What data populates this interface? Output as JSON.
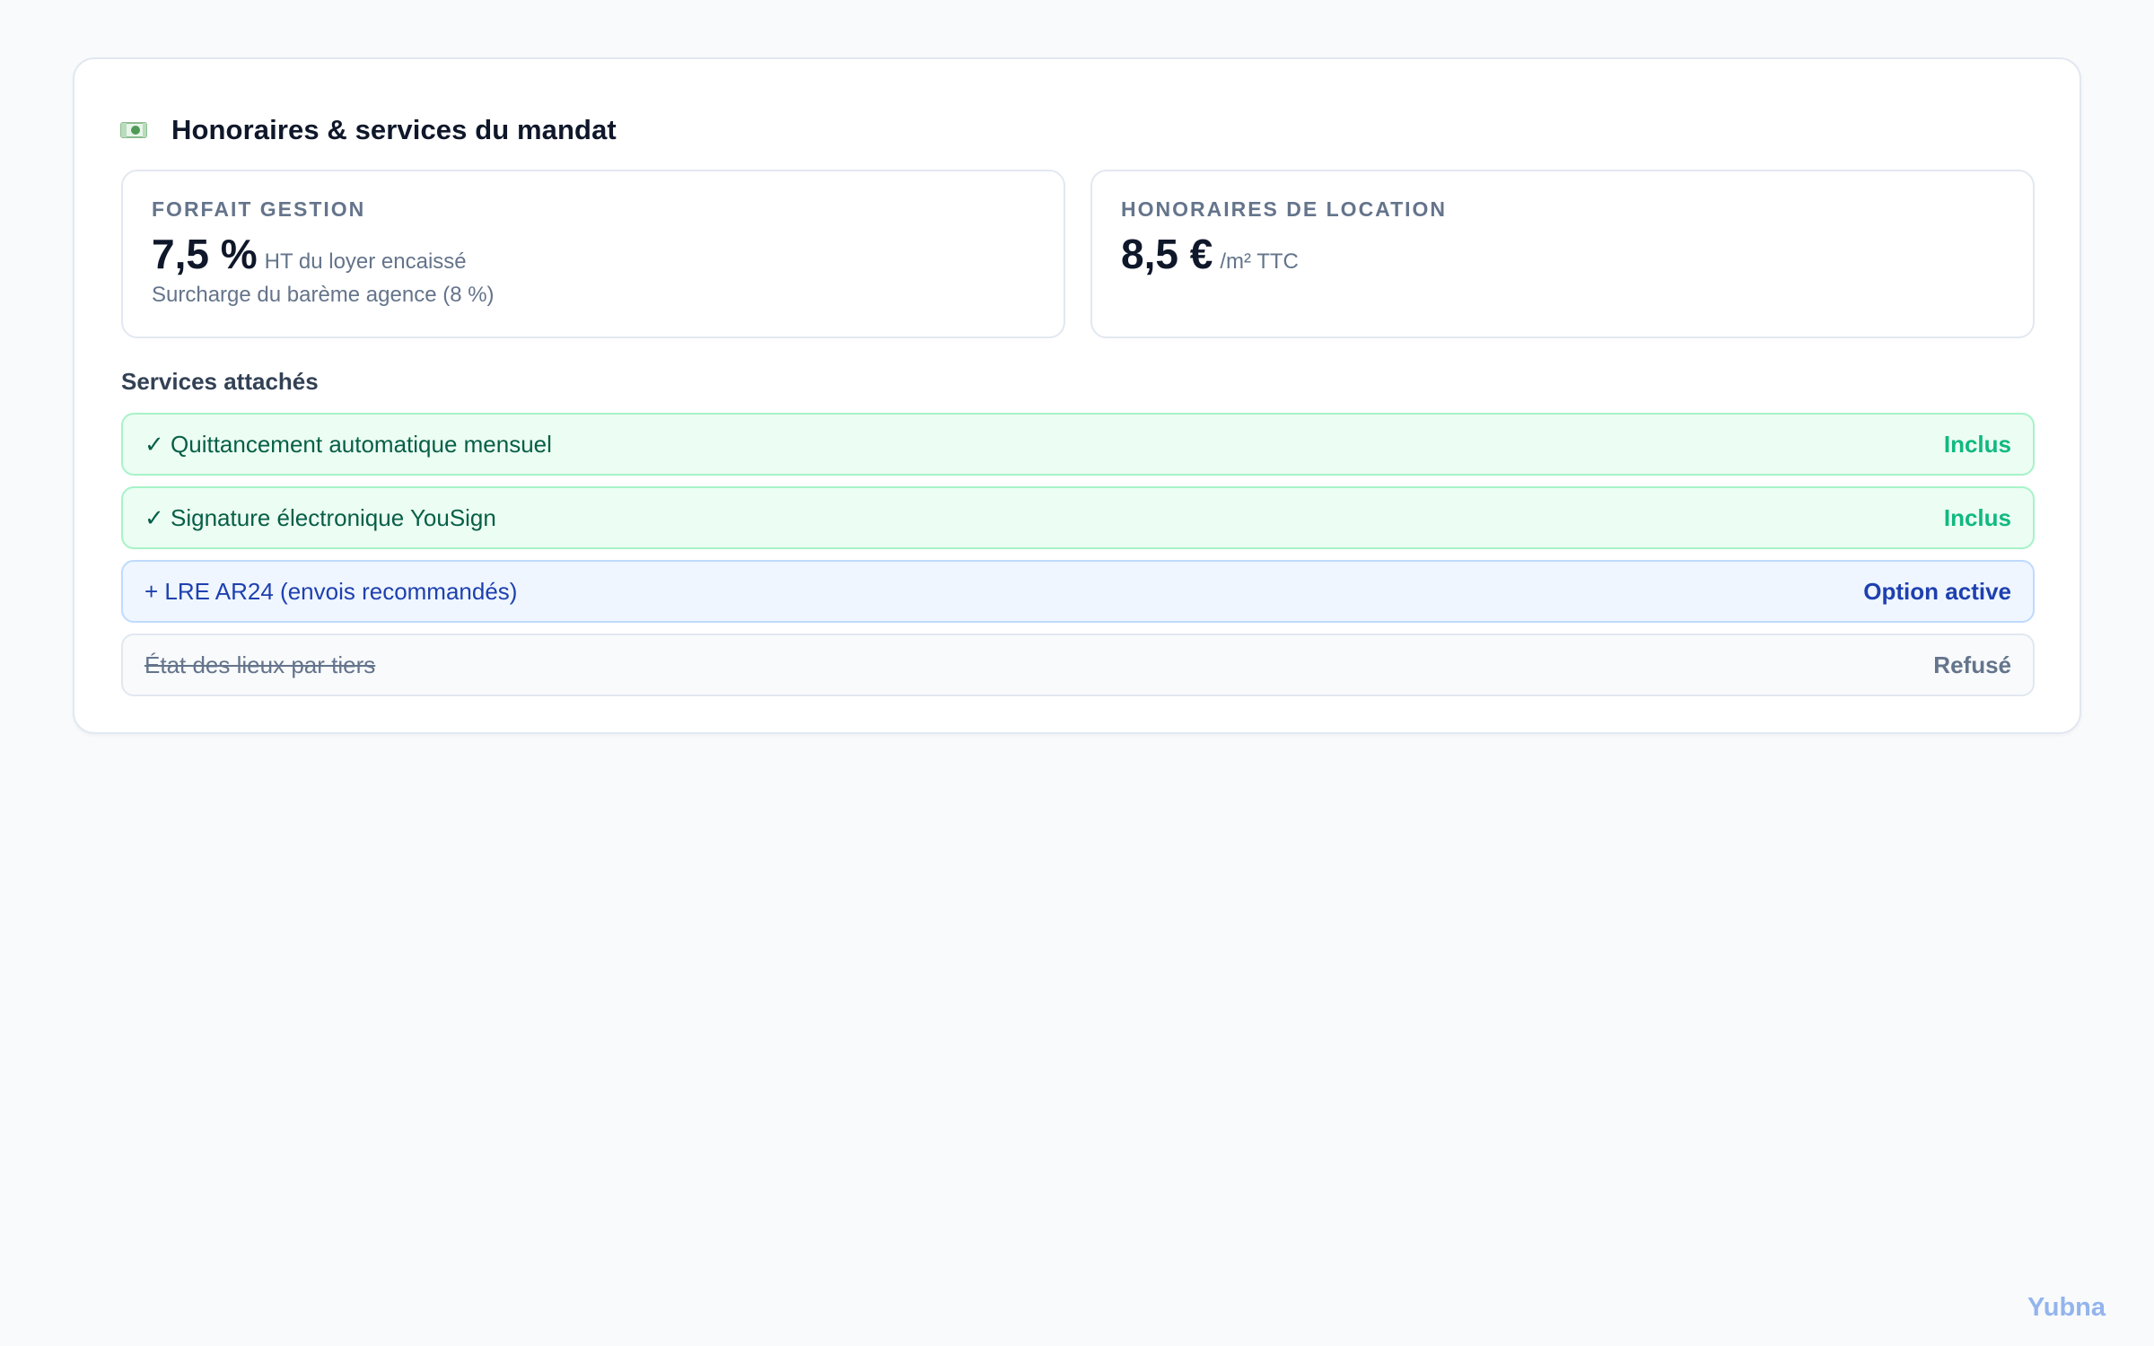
{
  "card": {
    "icon": "money-icon",
    "title": "Honoraires & services du mandat"
  },
  "fees": [
    {
      "label": "FORFAIT GESTION",
      "value": "7,5 %",
      "unit": "HT du loyer encaissé",
      "note": "Surcharge du barème agence (8 %)"
    },
    {
      "label": "HONORAIRES DE LOCATION",
      "value": "8,5 €",
      "unit": "/m² TTC",
      "note": ""
    }
  ],
  "services_section": {
    "title": "Services attachés",
    "items": [
      {
        "name": "✓ Quittancement automatique mensuel",
        "status": "Inclus",
        "state": "included"
      },
      {
        "name": "✓ Signature électronique YouSign",
        "status": "Inclus",
        "state": "included"
      },
      {
        "name": "+ LRE AR24 (envois recommandés)",
        "status": "Option active",
        "state": "option"
      },
      {
        "name": "État des lieux par tiers",
        "status": "Refusé",
        "state": "refused"
      }
    ]
  },
  "brand": "Yubna",
  "colors": {
    "included_bg": "#ecfdf3",
    "included_status": "#10b981",
    "option_status": "#1e40af",
    "refused_text": "#64748b",
    "brand": "#93b4ec"
  }
}
